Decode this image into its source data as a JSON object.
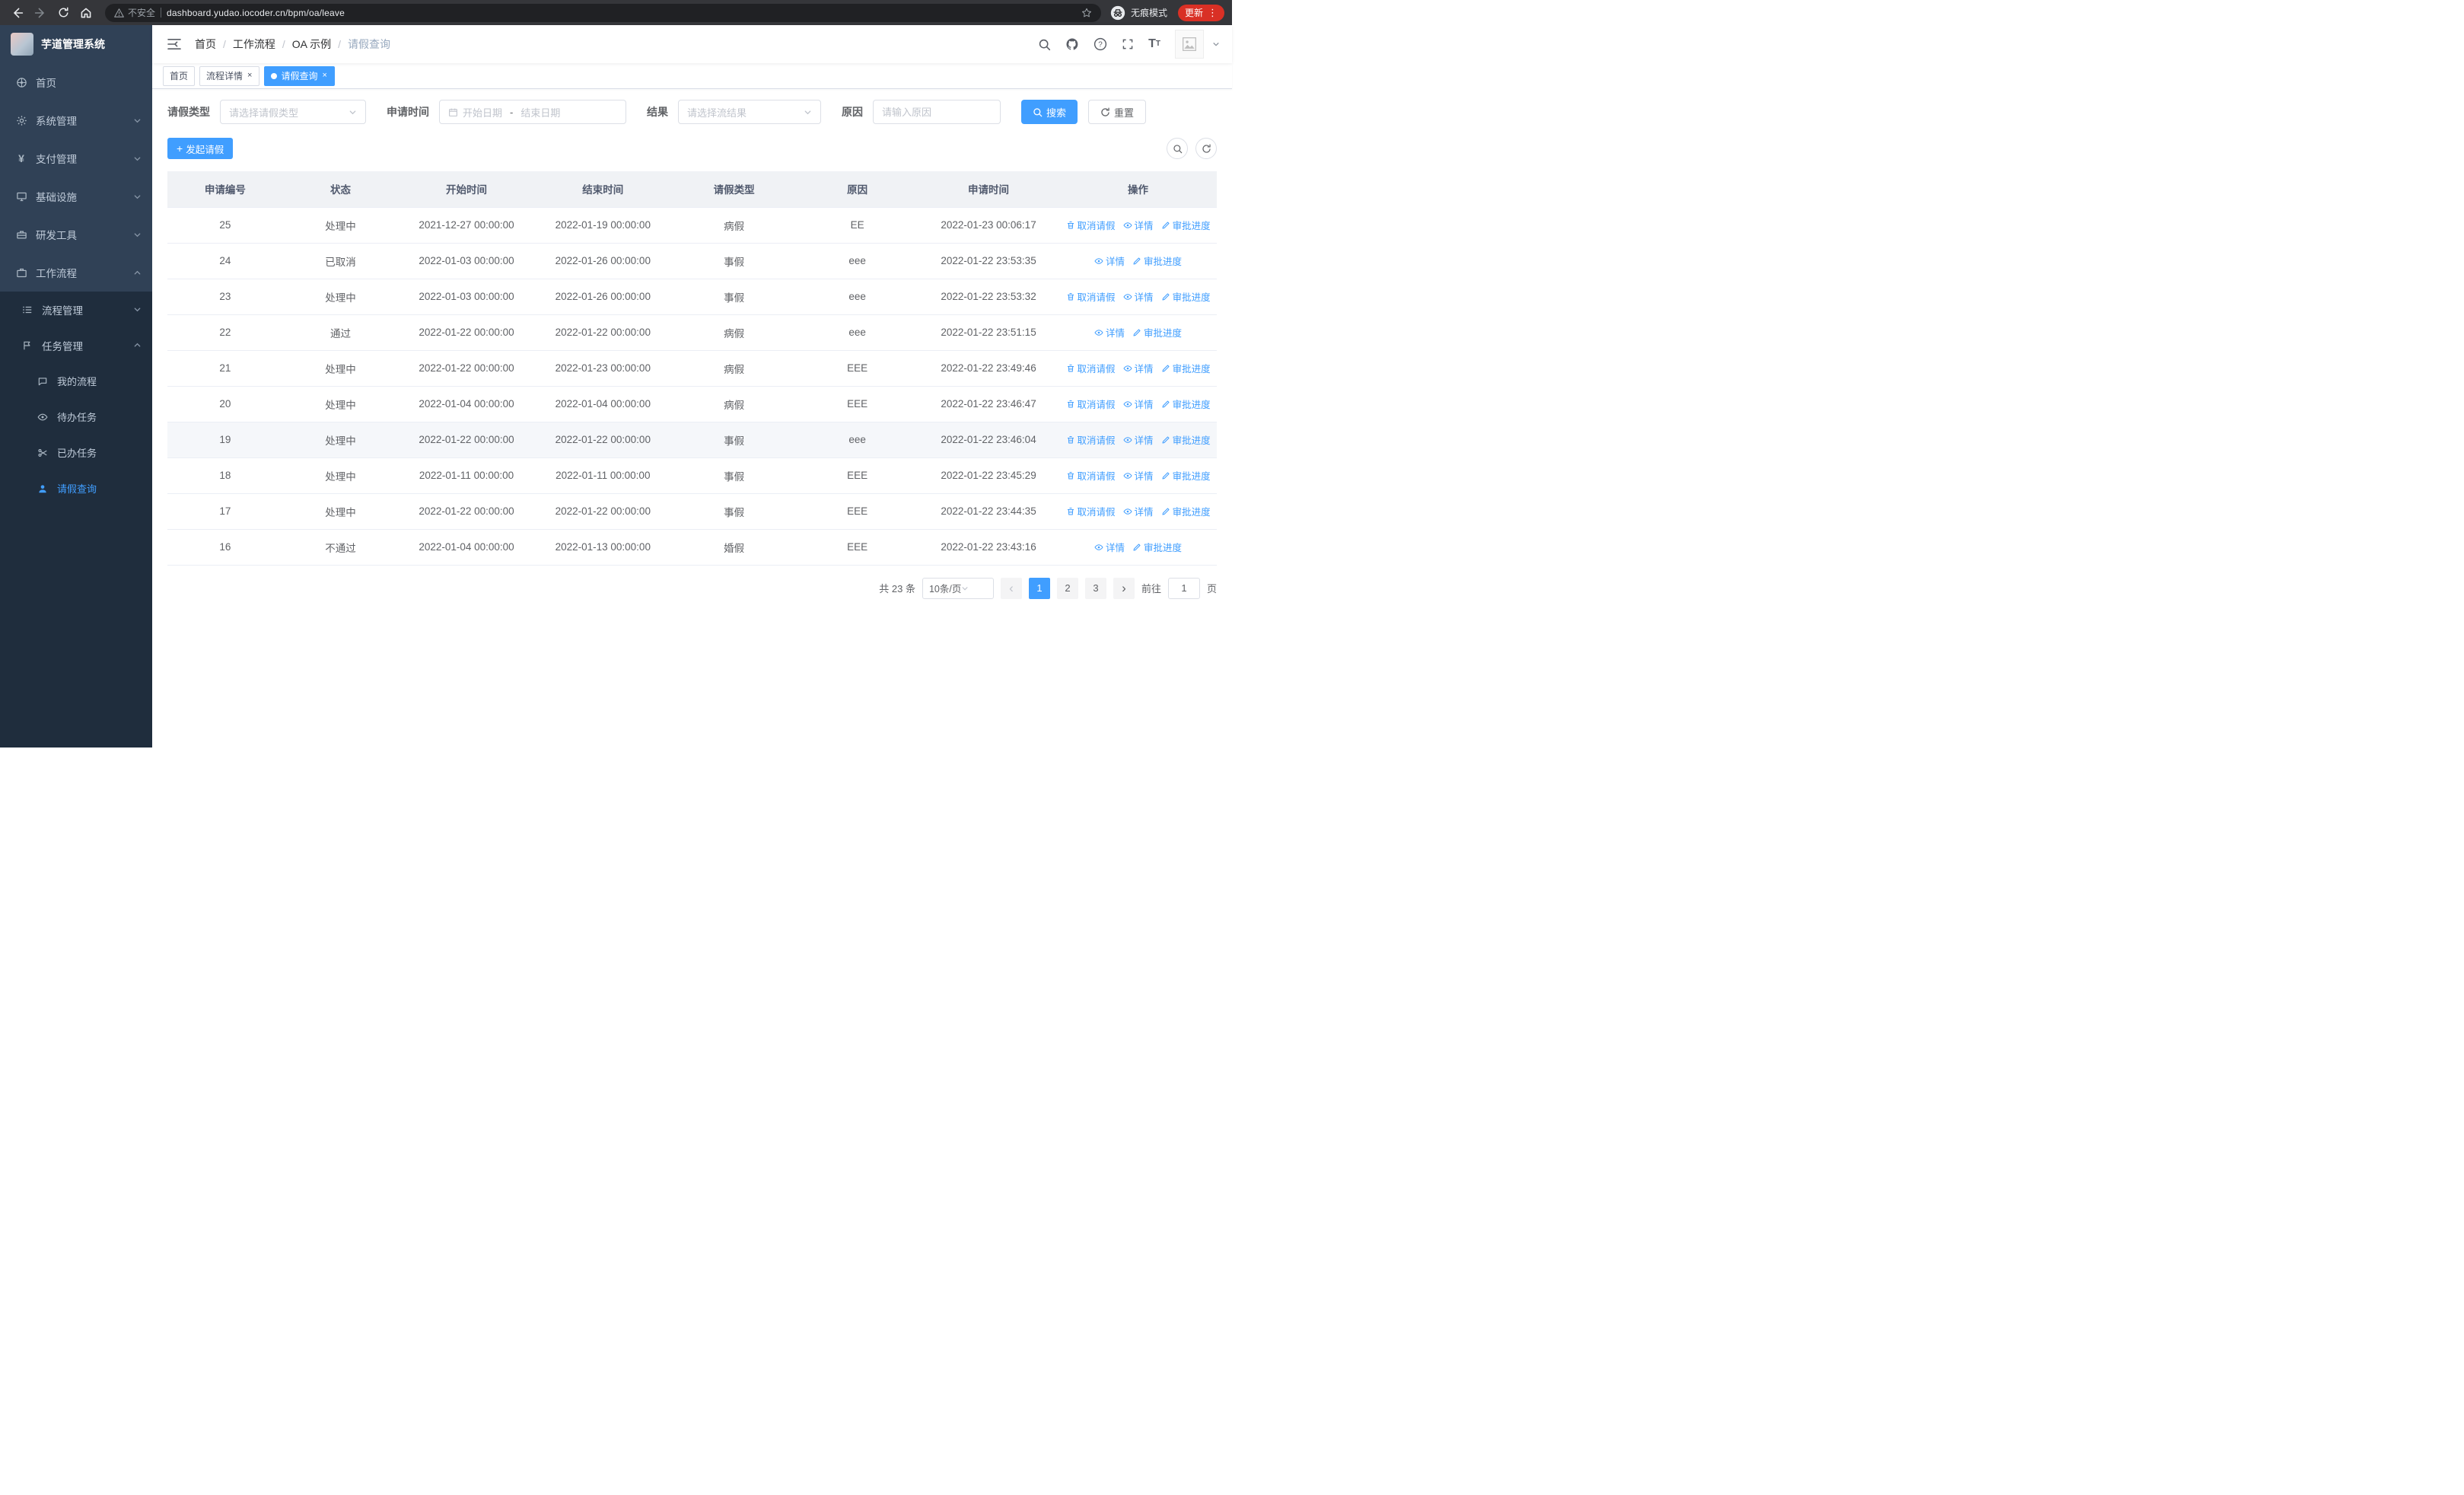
{
  "browser": {
    "security_label": "不安全",
    "url": "dashboard.yudao.iocoder.cn/bpm/oa/leave",
    "incognito_label": "无痕模式",
    "update_label": "更新"
  },
  "colors": {
    "accent": "#409eff",
    "sidebar_bg": "#304156",
    "submenu_bg": "#1f2d3d",
    "chrome_bg": "#35363a",
    "address_bar_bg": "#202124",
    "update_button_red": "#d93025",
    "table_header_bg": "#f0f2f5",
    "row_highlight_bg": "#f5f7fa"
  },
  "icons": {
    "header_right": [
      "search-icon",
      "github-icon",
      "help-icon",
      "fullscreen-icon",
      "font-size-icon",
      "avatar",
      "caret-down-icon"
    ],
    "row_actions": [
      "trash-icon",
      "eye-icon",
      "pen-icon"
    ]
  },
  "sidebar": {
    "title": "芋道管理系统",
    "items": [
      {
        "label": "首页"
      },
      {
        "label": "系统管理"
      },
      {
        "label": "支付管理"
      },
      {
        "label": "基础设施"
      },
      {
        "label": "研发工具"
      },
      {
        "label": "工作流程"
      }
    ],
    "submenu": {
      "process_mgmt": "流程管理",
      "task_mgmt": "任务管理",
      "children": [
        {
          "label": "我的流程"
        },
        {
          "label": "待办任务"
        },
        {
          "label": "已办任务"
        },
        {
          "label": "请假查询"
        }
      ]
    },
    "active_item": "请假查询"
  },
  "breadcrumb": {
    "items": [
      "首页",
      "工作流程",
      "OA 示例",
      "请假查询"
    ],
    "separator": "/"
  },
  "tabs": [
    {
      "label": "首页",
      "closable": false,
      "active": false
    },
    {
      "label": "流程详情",
      "closable": true,
      "active": false
    },
    {
      "label": "请假查询",
      "closable": true,
      "active": true
    }
  ],
  "filters": {
    "leave_type_label": "请假类型",
    "leave_type_placeholder": "请选择请假类型",
    "apply_time_label": "申请时间",
    "date_start_placeholder": "开始日期",
    "date_separator": "-",
    "date_end_placeholder": "结束日期",
    "result_label": "结果",
    "result_placeholder": "请选择流结果",
    "reason_label": "原因",
    "reason_placeholder": "请输入原因",
    "search_label": "搜索",
    "reset_label": "重置"
  },
  "toolbar": {
    "create_label": "发起请假"
  },
  "table": {
    "columns": [
      "申请编号",
      "状态",
      "开始时间",
      "结束时间",
      "请假类型",
      "原因",
      "申请时间",
      "操作"
    ],
    "actions": {
      "cancel": "取消请假",
      "detail": "详情",
      "progress": "审批进度"
    },
    "rows": [
      {
        "id": "25",
        "status": "处理中",
        "start": "2021-12-27 00:00:00",
        "end": "2022-01-19 00:00:00",
        "type": "病假",
        "reason": "EE",
        "apply_time": "2022-01-23 00:06:17",
        "cancellable": true,
        "highlighted": false
      },
      {
        "id": "24",
        "status": "已取消",
        "start": "2022-01-03 00:00:00",
        "end": "2022-01-26 00:00:00",
        "type": "事假",
        "reason": "eee",
        "apply_time": "2022-01-22 23:53:35",
        "cancellable": false,
        "highlighted": false
      },
      {
        "id": "23",
        "status": "处理中",
        "start": "2022-01-03 00:00:00",
        "end": "2022-01-26 00:00:00",
        "type": "事假",
        "reason": "eee",
        "apply_time": "2022-01-22 23:53:32",
        "cancellable": true,
        "highlighted": false
      },
      {
        "id": "22",
        "status": "通过",
        "start": "2022-01-22 00:00:00",
        "end": "2022-01-22 00:00:00",
        "type": "病假",
        "reason": "eee",
        "apply_time": "2022-01-22 23:51:15",
        "cancellable": false,
        "highlighted": false
      },
      {
        "id": "21",
        "status": "处理中",
        "start": "2022-01-22 00:00:00",
        "end": "2022-01-23 00:00:00",
        "type": "病假",
        "reason": "EEE",
        "apply_time": "2022-01-22 23:49:46",
        "cancellable": true,
        "highlighted": false
      },
      {
        "id": "20",
        "status": "处理中",
        "start": "2022-01-04 00:00:00",
        "end": "2022-01-04 00:00:00",
        "type": "病假",
        "reason": "EEE",
        "apply_time": "2022-01-22 23:46:47",
        "cancellable": true,
        "highlighted": false
      },
      {
        "id": "19",
        "status": "处理中",
        "start": "2022-01-22 00:00:00",
        "end": "2022-01-22 00:00:00",
        "type": "事假",
        "reason": "eee",
        "apply_time": "2022-01-22 23:46:04",
        "cancellable": true,
        "highlighted": true
      },
      {
        "id": "18",
        "status": "处理中",
        "start": "2022-01-11 00:00:00",
        "end": "2022-01-11 00:00:00",
        "type": "事假",
        "reason": "EEE",
        "apply_time": "2022-01-22 23:45:29",
        "cancellable": true,
        "highlighted": false
      },
      {
        "id": "17",
        "status": "处理中",
        "start": "2022-01-22 00:00:00",
        "end": "2022-01-22 00:00:00",
        "type": "事假",
        "reason": "EEE",
        "apply_time": "2022-01-22 23:44:35",
        "cancellable": true,
        "highlighted": false
      },
      {
        "id": "16",
        "status": "不通过",
        "start": "2022-01-04 00:00:00",
        "end": "2022-01-13 00:00:00",
        "type": "婚假",
        "reason": "EEE",
        "apply_time": "2022-01-22 23:43:16",
        "cancellable": false,
        "highlighted": false
      }
    ]
  },
  "pagination": {
    "total_label": "共 23 条",
    "page_size_label": "10条/页",
    "pages": [
      "1",
      "2",
      "3"
    ],
    "active_page": "1",
    "goto_label": "前往",
    "goto_value": "1",
    "unit_label": "页"
  }
}
